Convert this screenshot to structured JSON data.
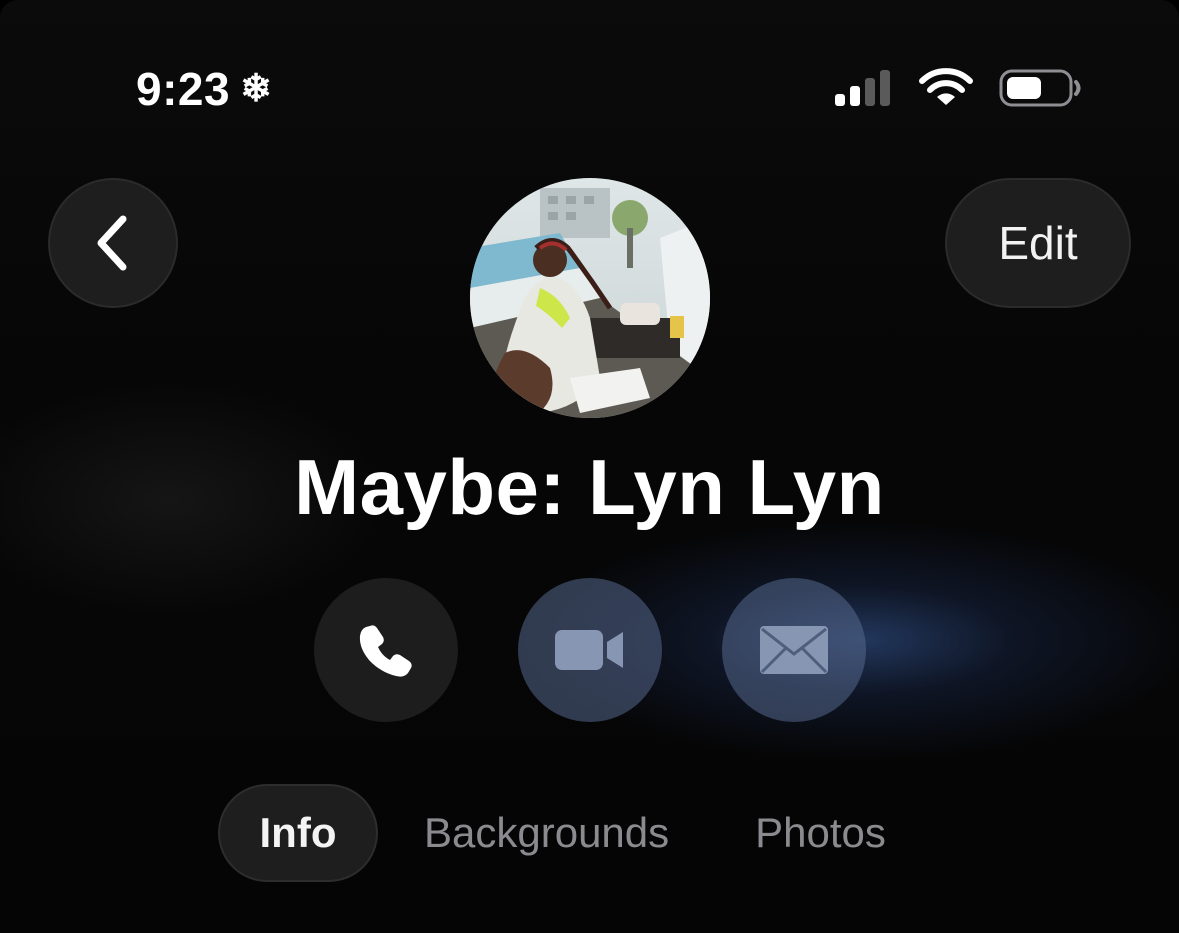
{
  "status_bar": {
    "time": "9:23",
    "focus_glyph": "❄",
    "icons": [
      "snowflake-icon",
      "cellular-signal-icon",
      "wifi-icon",
      "battery-icon"
    ],
    "signal_bars_filled": 2,
    "signal_bars_total": 4,
    "battery_level": 0.5
  },
  "header": {
    "back_icon": "chevron-left-icon",
    "edit_label": "Edit"
  },
  "contact": {
    "name": "Maybe: Lyn Lyn",
    "avatar_icon": "contact-photo"
  },
  "actions": [
    {
      "icon": "phone-icon",
      "enabled": true
    },
    {
      "icon": "video-camera-icon",
      "enabled": false
    },
    {
      "icon": "envelope-icon",
      "enabled": false
    }
  ],
  "tabs": [
    {
      "label": "Info",
      "active": true
    },
    {
      "label": "Backgrounds",
      "active": false
    },
    {
      "label": "Photos",
      "active": false
    }
  ],
  "colors": {
    "background": "#000000",
    "button_bg": "#1e1e1e",
    "disabled_action_bg": "#56688c",
    "accent_glow": "#32528c"
  }
}
